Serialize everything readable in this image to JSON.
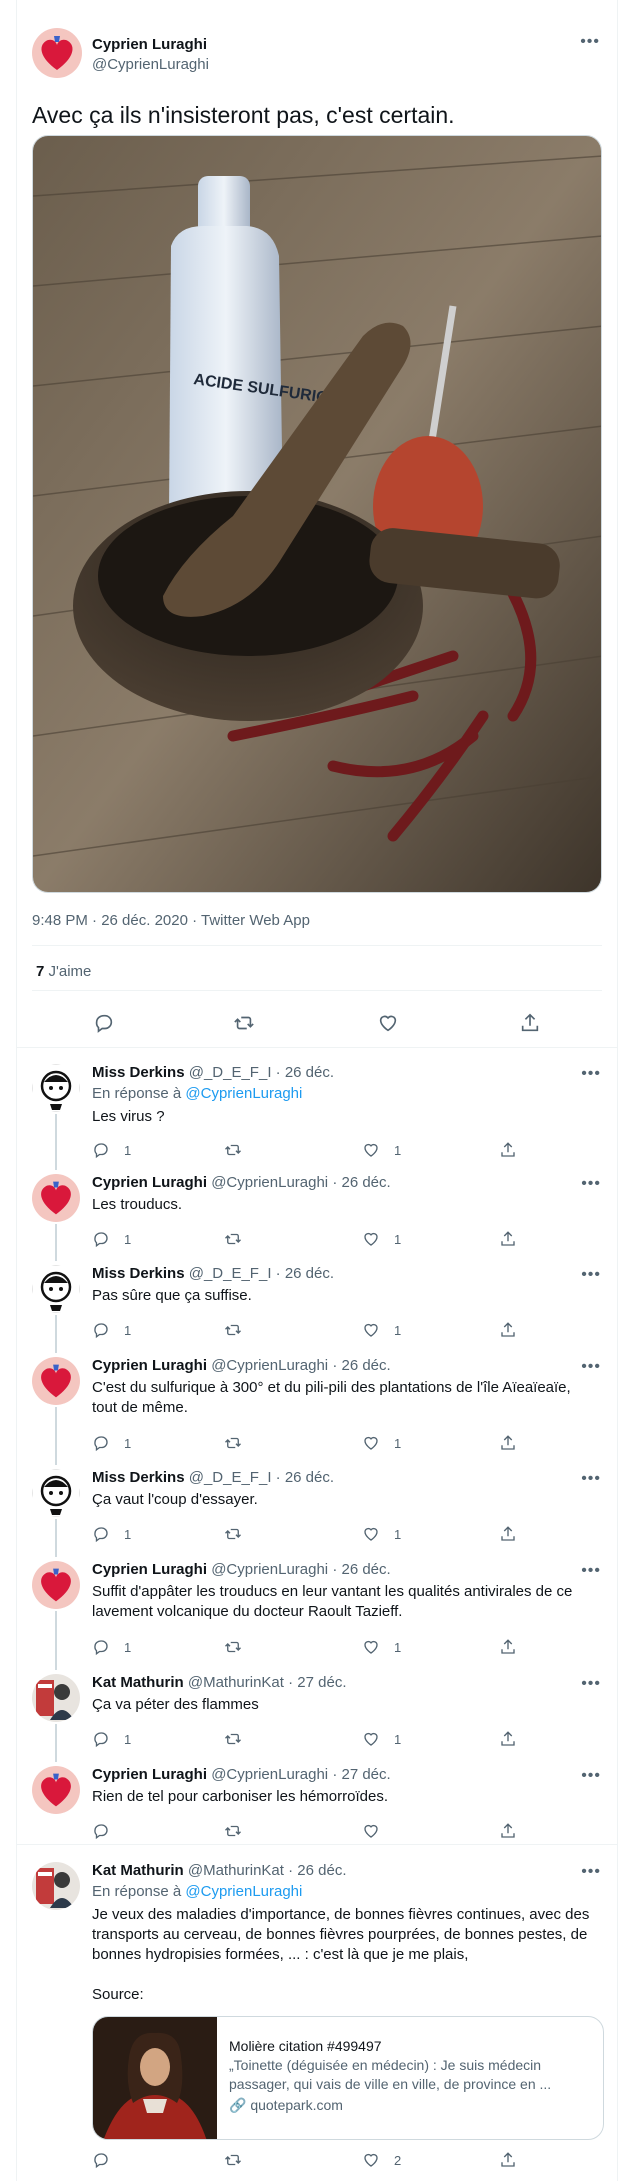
{
  "main_tweet": {
    "author_name": "Cyprien Luraghi",
    "author_handle": "@CyprienLuraghi",
    "text": "Avec ça ils n'insisteront pas, c'est certain.",
    "photo_label": "ACIDE SULFURIQUE",
    "timestamp": "9:48 PM · 26 déc. 2020 · Twitter Web App",
    "likes_count": "7",
    "likes_label": "J'aime"
  },
  "replies": [
    {
      "name": "Miss Derkins",
      "handle": "@_D_E_F_I",
      "date": "· 26 déc.",
      "in_reply_prefix": "En réponse à",
      "in_reply_handle": "@CyprienLuraghi",
      "text": "Les virus ?",
      "reply_count": "1",
      "retweet_count": "",
      "like_count": "1"
    },
    {
      "name": "Cyprien Luraghi",
      "handle": "@CyprienLuraghi",
      "date": "· 26 déc.",
      "text": "Les trouducs.",
      "reply_count": "1",
      "retweet_count": "",
      "like_count": "1"
    },
    {
      "name": "Miss Derkins",
      "handle": "@_D_E_F_I",
      "date": "· 26 déc.",
      "text": "Pas sûre que ça suffise.",
      "reply_count": "1",
      "retweet_count": "",
      "like_count": "1"
    },
    {
      "name": "Cyprien Luraghi",
      "handle": "@CyprienLuraghi",
      "date": "· 26 déc.",
      "text_line1": "C'est du sulfurique à 300° et du pili-pili des plantations de l'île Aïeaïeaïe,",
      "text_line2": "tout de même.",
      "reply_count": "1",
      "retweet_count": "",
      "like_count": "1"
    },
    {
      "name": "Miss Derkins",
      "handle": "@_D_E_F_I",
      "date": "· 26 déc.",
      "text": "Ça vaut l'coup d'essayer.",
      "reply_count": "1",
      "retweet_count": "",
      "like_count": "1"
    },
    {
      "name": "Cyprien Luraghi",
      "handle": "@CyprienLuraghi",
      "date": "· 26 déc.",
      "text_line1": "Suffit d'appâter les trouducs en leur vantant les qualités antivirales de ce",
      "text_line2": "lavement volcanique du docteur Raoult Tazieff.",
      "reply_count": "1",
      "retweet_count": "",
      "like_count": "1"
    },
    {
      "name": "Kat Mathurin",
      "handle": "@MathurinKat",
      "date": "· 27 déc.",
      "text": "Ça va péter des flammes",
      "reply_count": "1",
      "retweet_count": "",
      "like_count": "1"
    },
    {
      "name": "Cyprien Luraghi",
      "handle": "@CyprienLuraghi",
      "date": "· 27 déc.",
      "text": "Rien de tel pour carboniser les hémorroïdes.",
      "reply_count": "",
      "retweet_count": "",
      "like_count": ""
    },
    {
      "name": "Kat Mathurin",
      "handle": "@MathurinKat",
      "date": "· 26 déc.",
      "in_reply_prefix": "En réponse à",
      "in_reply_handle": "@CyprienLuraghi",
      "text_line1": "Je veux des maladies d'importance, de bonnes fièvres continues, avec des",
      "text_line2": "transports au cerveau, de bonnes fièvres pourprées, de bonnes pestes, de",
      "text_line3": "bonnes hydropisies formées, ... : c'est là que je me plais,",
      "text_source": "Source:",
      "reply_count": "",
      "retweet_count": "",
      "like_count": "2",
      "card": {
        "title": "Molière citation #499497",
        "desc_line1": "„Toinette (déguisée en médecin) : Je suis médecin",
        "desc_line2": "passager, qui vais de ville en ville, de province en ...",
        "domain": "quotepark.com"
      }
    }
  ],
  "colors": {
    "accent": "#1d9bf0",
    "secondary_text": "#536471",
    "border": "#cfd9de"
  }
}
